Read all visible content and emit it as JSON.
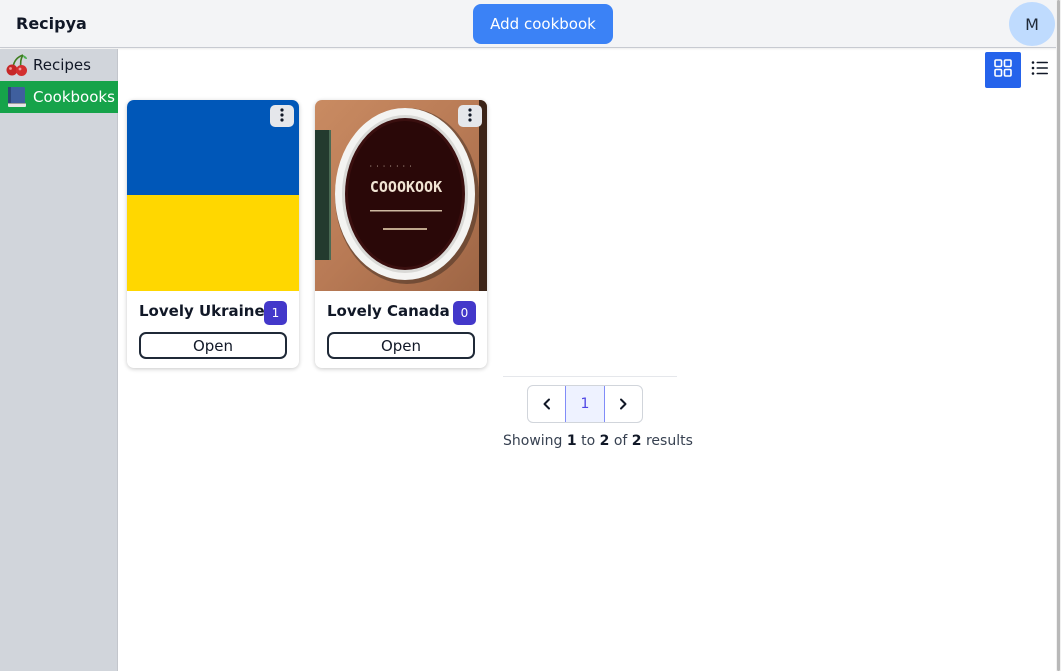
{
  "app": {
    "title": "Recipya",
    "user_initial": "M"
  },
  "header": {
    "add_button": "Add cookbook"
  },
  "sidebar": {
    "items": [
      {
        "label": "Recipes",
        "icon": "cherries-icon",
        "active": false
      },
      {
        "label": "Cookbooks",
        "icon": "book-icon",
        "active": true
      }
    ]
  },
  "view_toggle": {
    "selected": "grid",
    "options": [
      "grid",
      "list"
    ]
  },
  "cookbooks": [
    {
      "title": "Lovely Ukraine",
      "count": "1",
      "open_label": "Open",
      "image": "ukraine-flag"
    },
    {
      "title": "Lovely Canada",
      "count": "0",
      "open_label": "Open",
      "image": "cookbook-cover",
      "cover_text": "COOOKOOK"
    }
  ],
  "pagination": {
    "current_page": "1",
    "showing_prefix": "Showing",
    "from": "1",
    "to_word": "to",
    "to": "2",
    "of_word": "of",
    "total": "2",
    "suffix": "results"
  },
  "colors": {
    "accent": "#3b82f6",
    "active_nav": "#16a34a",
    "badge": "#4338ca",
    "flag_blue": "#0057b8",
    "flag_yellow": "#ffd700"
  }
}
